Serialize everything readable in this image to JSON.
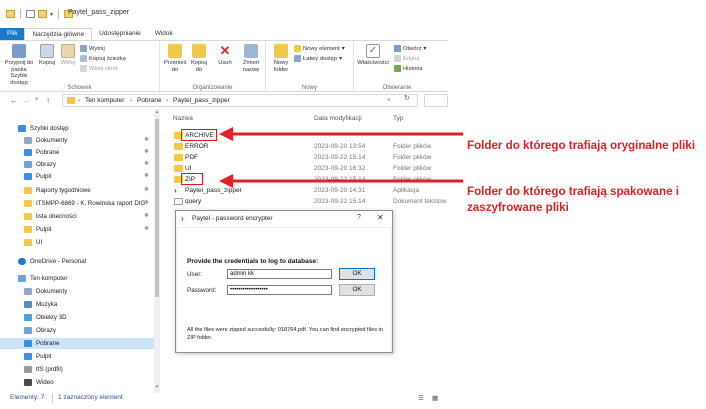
{
  "window": {
    "title": "Paytel_pass_zipper"
  },
  "ribbon": {
    "tabs": [
      "Plik",
      "Narzędzia główne",
      "Udostępnianie",
      "Widok"
    ],
    "groups": {
      "clipboard": {
        "label": "Schowek",
        "pin": "Przypnij do paska Szybki dostęp",
        "copy": "Kopiuj",
        "paste": "Wklej",
        "cut": "Wytnij",
        "copy_path": "Kopiuj ścieżkę",
        "paste_shortcut": "Wklej skrót"
      },
      "organize": {
        "label": "Organizowanie",
        "move_to": "Przenieś do",
        "copy_to": "Kopiuj do",
        "delete": "Usuń",
        "rename": "Zmień nazwę"
      },
      "new": {
        "label": "Nowy",
        "new_folder": "Nowy folder",
        "new_item": "Nowy element",
        "easy_access": "Łatwy dostęp"
      },
      "open": {
        "label": "Otwieranie",
        "properties": "Właściwości",
        "open": "Otwórz",
        "edit": "Edytuj",
        "history": "Historia"
      }
    }
  },
  "address": {
    "crumbs": [
      "Ten komputer",
      "Pobrane",
      "Paytel_pass_zipper"
    ]
  },
  "nav": {
    "items": [
      {
        "label": "Szybki dostęp",
        "pinned": false
      },
      {
        "label": "Dokumenty",
        "pinned": true
      },
      {
        "label": "Pobrane",
        "pinned": true
      },
      {
        "label": "Obrazy",
        "pinned": true
      },
      {
        "label": "Pulpit",
        "pinned": true
      },
      {
        "label": "Raporty tygodniowe",
        "pinned": true
      },
      {
        "label": "ITSMPP-6869 - K. Rowinska raport DIG",
        "pinned": true
      },
      {
        "label": "lista obecności",
        "pinned": true
      },
      {
        "label": "Pulpit",
        "pinned": true
      },
      {
        "label": "UI",
        "pinned": false
      },
      {
        "label": "OneDrive - Personal",
        "pinned": false
      },
      {
        "label": "Ten komputer",
        "pinned": false
      },
      {
        "label": "Dokumenty",
        "pinned": false
      },
      {
        "label": "Muzyka",
        "pinned": false
      },
      {
        "label": "Obiekty 3D",
        "pinned": false
      },
      {
        "label": "Obrazy",
        "pinned": false
      },
      {
        "label": "Pobrane",
        "pinned": false
      },
      {
        "label": "Pulpit",
        "pinned": false
      },
      {
        "label": "tfS (prdfil)",
        "pinned": false
      },
      {
        "label": "Wideo",
        "pinned": false
      }
    ]
  },
  "filelist": {
    "headers": {
      "name": "Nazwa",
      "date": "Data modyfikacji",
      "type": "Typ"
    },
    "files": [
      {
        "name": "ARCHIVE",
        "date": "",
        "type": ""
      },
      {
        "name": "ERROR",
        "date": "2023-09-20 13:54",
        "type": "Folder plików"
      },
      {
        "name": "PDF",
        "date": "2023-09-22 15:14",
        "type": "Folder plików"
      },
      {
        "name": "UI",
        "date": "2023-09-20 16:32",
        "type": "Folder plików"
      },
      {
        "name": "ZIP",
        "date": "2023-09-22 15:14",
        "type": "Folder plików"
      },
      {
        "name": "Paytel_pass_zipper",
        "date": "2023-09-20 14:31",
        "type": "Aplikacja"
      },
      {
        "name": "query",
        "date": "2023-09-22 15:14",
        "type": "Dokument tekstow"
      }
    ]
  },
  "status": {
    "count": "Elementy: 7",
    "selected": "1 zaznaczony element"
  },
  "dialog": {
    "title": "Paytel - password encrypter",
    "help": "?",
    "close": "✕",
    "prompt": "Provide the credentials to log to database:",
    "user_label": "User:",
    "user_value": "admin kk",
    "password_label": "Password:",
    "password_value": "••••••••••••••••••",
    "ok_label": "OK",
    "info": "All the files were zipped succesfully: 018764.pdf. You can find encrypted files in ZIP folder."
  },
  "annotations": {
    "archive_note": "Folder do którego trafiają oryginalne pliki",
    "zip_note": "Folder do którego trafiają spakowane i zaszyfrowane pliki",
    "color": "#e01f26"
  }
}
